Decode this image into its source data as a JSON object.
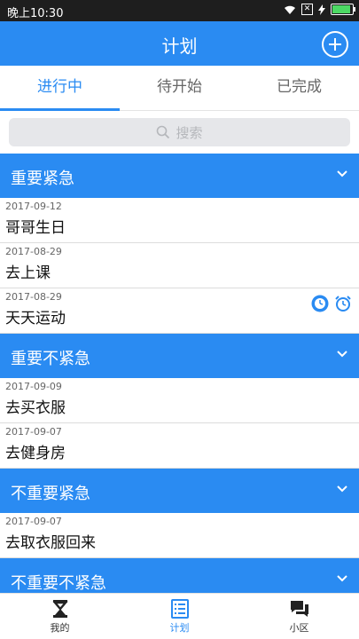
{
  "status_bar": {
    "time": "晚上10:30"
  },
  "header": {
    "title": "计划"
  },
  "tabs": [
    {
      "label": "进行中"
    },
    {
      "label": "待开始"
    },
    {
      "label": "已完成"
    }
  ],
  "search": {
    "placeholder": "搜索"
  },
  "sections": [
    {
      "title": "重要紧急",
      "items": [
        {
          "date": "2017-09-12",
          "name": "哥哥生日"
        },
        {
          "date": "2017-08-29",
          "name": "去上课"
        },
        {
          "date": "2017-08-29",
          "name": "天天运动",
          "icons": [
            "timer-icon",
            "alarm-clock-icon"
          ]
        }
      ]
    },
    {
      "title": "重要不紧急",
      "items": [
        {
          "date": "2017-09-09",
          "name": "去买衣服"
        },
        {
          "date": "2017-09-07",
          "name": "去健身房"
        }
      ]
    },
    {
      "title": "不重要紧急",
      "items": [
        {
          "date": "2017-09-07",
          "name": "去取衣服回来"
        }
      ]
    },
    {
      "title": "不重要不紧急",
      "items": []
    }
  ],
  "bottom_nav": [
    {
      "label": "我的",
      "icon": "hourglass-icon"
    },
    {
      "label": "计划",
      "icon": "list-icon"
    },
    {
      "label": "小区",
      "icon": "chat-icon"
    }
  ],
  "colors": {
    "accent": "#2a8bf2",
    "status_bar": "#1e1e1e"
  }
}
